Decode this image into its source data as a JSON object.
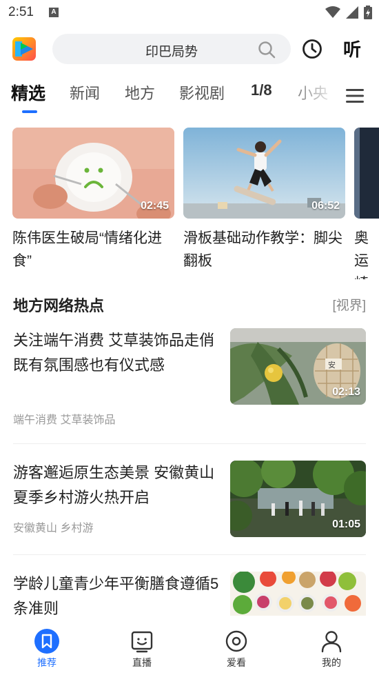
{
  "status_bar": {
    "time": "2:51",
    "notification": "A"
  },
  "header": {
    "search_query": "印巴局势",
    "listen_label": "听"
  },
  "tabs": [
    {
      "label": "精选",
      "active": true
    },
    {
      "label": "新闻"
    },
    {
      "label": "地方"
    },
    {
      "label": "影视剧"
    },
    {
      "label": "1/8"
    },
    {
      "label": "小央"
    }
  ],
  "video_cards": [
    {
      "title": "陈伟医生破局“情绪化进食”",
      "duration": "02:45"
    },
    {
      "title": "滑板基础动作教学：脚尖翻板",
      "duration": "06:52"
    },
    {
      "title": "奥运崎琪",
      "duration": ""
    }
  ],
  "section": {
    "title": "地方网络热点",
    "source": "[视界]"
  },
  "news": [
    {
      "title": "关注端午消费 艾草装饰品走俏 既有氛围感也有仪式感",
      "tags": "端午消费 艾草装饰品",
      "duration": "02:13"
    },
    {
      "title": "游客邂逅原生态美景 安徽黄山夏季乡村游火热开启",
      "tags": "安徽黄山 乡村游",
      "duration": "01:05"
    },
    {
      "title": "学龄儿童青少年平衡膳食遵循5条准则",
      "tags": "",
      "duration": ""
    }
  ],
  "bottom_nav": [
    {
      "label": "推荐",
      "icon": "bookmark-icon",
      "active": true
    },
    {
      "label": "直播",
      "icon": "tv-face-icon"
    },
    {
      "label": "爱看",
      "icon": "target-icon"
    },
    {
      "label": "我的",
      "icon": "person-icon"
    }
  ],
  "colors": {
    "accent": "#1e6fff",
    "text": "#222222",
    "muted": "#999999",
    "search_bg": "#f1f2f4"
  }
}
